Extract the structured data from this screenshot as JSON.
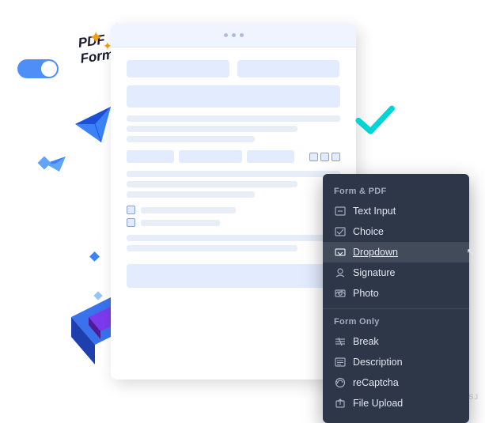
{
  "document": {
    "header_dots": [
      "dot1",
      "dot2",
      "dot3"
    ]
  },
  "decorations": {
    "pdf_form_label_line1": "PDF",
    "pdf_form_label_line2": "Form",
    "checkmark_color": "#00d4d4",
    "cube_front_color": "#2d6fff",
    "cube_inner_color": "#5b21b6"
  },
  "context_menu": {
    "section1_label": "Form & PDF",
    "items_section1": [
      {
        "id": "text-input",
        "label": "Text Input",
        "icon": "text-input-icon"
      },
      {
        "id": "choice",
        "label": "Choice",
        "icon": "choice-icon"
      },
      {
        "id": "dropdown",
        "label": "Dropdown",
        "icon": "dropdown-icon",
        "active": true
      },
      {
        "id": "signature",
        "label": "Signature",
        "icon": "signature-icon"
      },
      {
        "id": "photo",
        "label": "Photo",
        "icon": "photo-icon"
      }
    ],
    "section2_label": "Form Only",
    "items_section2": [
      {
        "id": "break",
        "label": "Break",
        "icon": "break-icon"
      },
      {
        "id": "description",
        "label": "Description",
        "icon": "description-icon"
      },
      {
        "id": "recaptcha",
        "label": "reCaptcha",
        "icon": "recaptcha-icon"
      },
      {
        "id": "file-upload",
        "label": "File Upload",
        "icon": "file-upload-icon"
      }
    ]
  },
  "watermark": {
    "text": "WSJ"
  }
}
